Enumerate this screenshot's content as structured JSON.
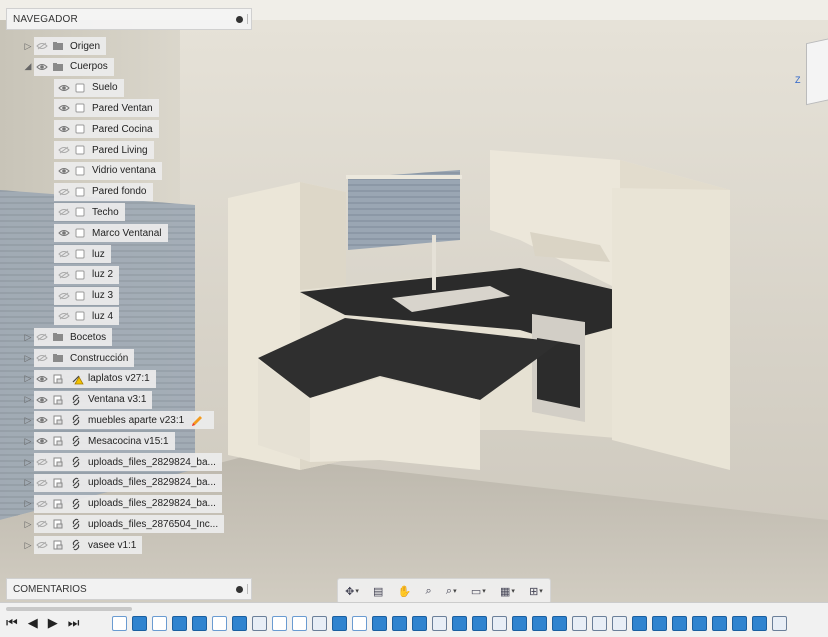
{
  "navigator": {
    "title": "NAVEGADOR",
    "items": [
      {
        "label": "Origen",
        "level": 0,
        "expander": "right",
        "visible": false,
        "icon": "folder-icon"
      },
      {
        "label": "Cuerpos",
        "level": 0,
        "expander": "down",
        "visible": true,
        "icon": "folder-icon"
      },
      {
        "label": "Suelo",
        "level": 1,
        "visible": true,
        "icon": "body-icon"
      },
      {
        "label": "Pared Ventan",
        "level": 1,
        "visible": true,
        "icon": "body-icon"
      },
      {
        "label": "Pared Cocina",
        "level": 1,
        "visible": true,
        "icon": "body-icon"
      },
      {
        "label": "Pared Living",
        "level": 1,
        "visible": false,
        "icon": "body-icon"
      },
      {
        "label": "Vidrio ventana",
        "level": 1,
        "visible": true,
        "icon": "body-icon"
      },
      {
        "label": "Pared fondo",
        "level": 1,
        "visible": false,
        "icon": "body-icon"
      },
      {
        "label": "Techo",
        "level": 1,
        "visible": false,
        "icon": "body-icon"
      },
      {
        "label": "Marco Ventanal",
        "level": 1,
        "visible": true,
        "icon": "body-icon"
      },
      {
        "label": "luz",
        "level": 1,
        "visible": false,
        "icon": "body-icon"
      },
      {
        "label": "luz 2",
        "level": 1,
        "visible": false,
        "icon": "body-icon"
      },
      {
        "label": "luz 3",
        "level": 1,
        "visible": false,
        "icon": "body-icon"
      },
      {
        "label": "luz 4",
        "level": 1,
        "visible": false,
        "icon": "body-icon"
      },
      {
        "label": "Bocetos",
        "level": 0,
        "expander": "right",
        "visible": false,
        "icon": "folder-icon"
      },
      {
        "label": "Construcción",
        "level": 0,
        "expander": "right",
        "visible": false,
        "icon": "folder-icon"
      },
      {
        "label": "laplatos v27:1",
        "level": 0,
        "expander": "right",
        "visible": true,
        "icon": "component-icon",
        "link": "warning-link-icon"
      },
      {
        "label": "Ventana v3:1",
        "level": 0,
        "expander": "right",
        "visible": true,
        "icon": "component-icon",
        "link": "link-icon"
      },
      {
        "label": "muebles aparte v23:1",
        "level": 0,
        "expander": "right",
        "visible": true,
        "icon": "component-icon",
        "link": "link-icon",
        "badge": "pencil-icon"
      },
      {
        "label": "Mesacocina v15:1",
        "level": 0,
        "expander": "right",
        "visible": true,
        "icon": "component-icon",
        "link": "link-icon"
      },
      {
        "label": "uploads_files_2829824_ba...",
        "level": 0,
        "expander": "right",
        "visible": false,
        "icon": "component-icon",
        "link": "link-icon"
      },
      {
        "label": "uploads_files_2829824_ba...",
        "level": 0,
        "expander": "right",
        "visible": false,
        "icon": "component-icon",
        "link": "link-icon"
      },
      {
        "label": "uploads_files_2829824_ba...",
        "level": 0,
        "expander": "right",
        "visible": false,
        "icon": "component-icon",
        "link": "link-icon"
      },
      {
        "label": "uploads_files_2876504_Inc...",
        "level": 0,
        "expander": "right",
        "visible": false,
        "icon": "component-icon",
        "link": "link-icon"
      },
      {
        "label": "vasee v1:1",
        "level": 0,
        "expander": "right",
        "visible": false,
        "icon": "component-icon",
        "link": "link-icon"
      }
    ]
  },
  "comments": {
    "title": "COMENTARIOS"
  },
  "viewcube": {
    "axis_label": "Z"
  },
  "toolbar": {
    "tools": [
      "orbit-icon",
      "look-at-icon",
      "pan-icon",
      "zoom-fit-icon",
      "zoom-window-icon",
      "display-settings-icon",
      "grid-icon",
      "viewports-icon"
    ]
  },
  "timeline": {
    "controls": [
      "go-to-start-icon",
      "step-back-icon",
      "play-icon",
      "step-forward-icon",
      "go-to-end-icon"
    ],
    "items": [
      "sketch",
      "body",
      "sketch",
      "body",
      "body",
      "sketch",
      "body",
      "comp",
      "sketch",
      "sketch",
      "comp",
      "body",
      "sketch",
      "body",
      "body",
      "body",
      "comp",
      "body",
      "body",
      "comp",
      "body",
      "body",
      "body",
      "comp",
      "comp",
      "comp",
      "body",
      "body",
      "body",
      "body",
      "body",
      "body",
      "body",
      "comp"
    ]
  },
  "colors": {
    "accent": "#2f83cf",
    "countertop": "#2b2b2b",
    "cabinet": "#efeadc",
    "wall": "#dcd7cc"
  }
}
